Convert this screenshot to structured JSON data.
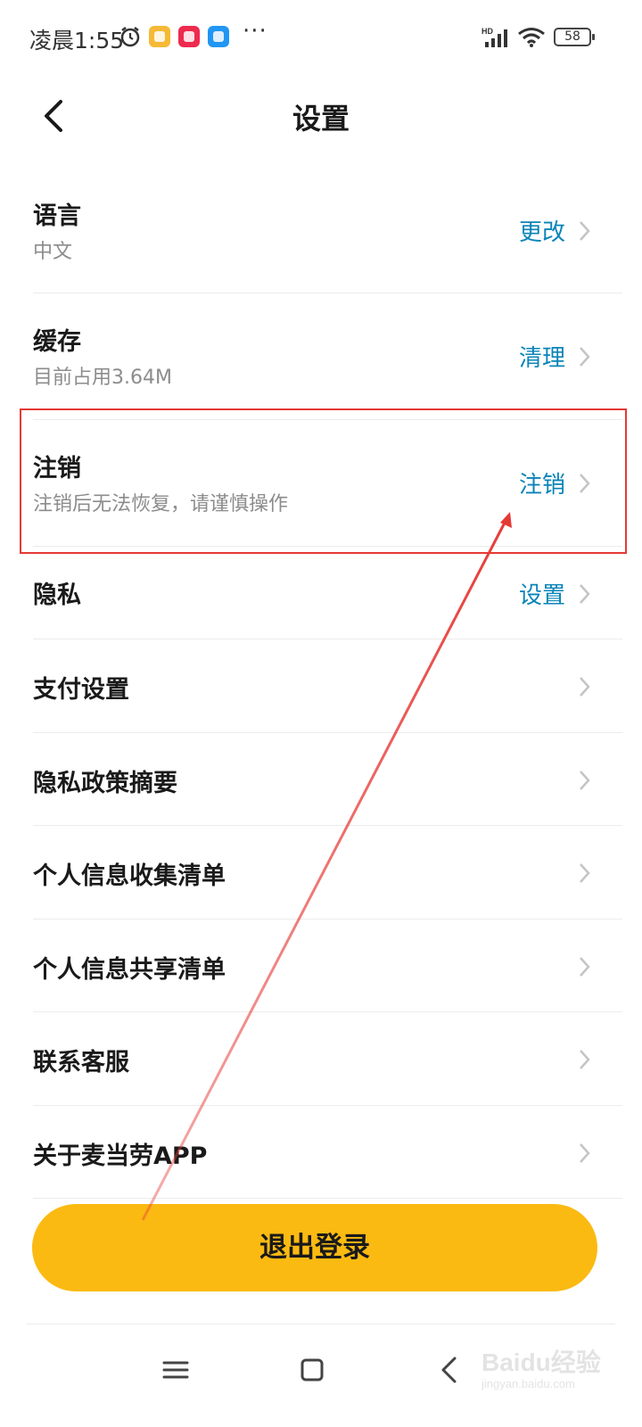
{
  "status_bar": {
    "time": "凌晨1:55",
    "more": "···",
    "battery": "58",
    "network": "HD",
    "icons": [
      "alarm-icon",
      "app-notification-icon",
      "xiaohongshu-icon",
      "cloud-icon",
      "signal-icon",
      "wifi-icon",
      "battery-icon"
    ]
  },
  "header": {
    "title": "设置"
  },
  "settings": [
    {
      "title": "语言",
      "subtitle": "中文",
      "action": "更改"
    },
    {
      "title": "缓存",
      "subtitle": "目前占用3.64M",
      "action": "清理"
    },
    {
      "title": "注销",
      "subtitle": "注销后无法恢复，请谨慎操作",
      "action": "注销"
    },
    {
      "title": "隐私",
      "subtitle": "",
      "action": "设置"
    },
    {
      "title": "支付设置",
      "subtitle": "",
      "action": ""
    },
    {
      "title": "隐私政策摘要",
      "subtitle": "",
      "action": ""
    },
    {
      "title": "个人信息收集清单",
      "subtitle": "",
      "action": ""
    },
    {
      "title": "个人信息共享清单",
      "subtitle": "",
      "action": ""
    },
    {
      "title": "联系客服",
      "subtitle": "",
      "action": ""
    },
    {
      "title": "关于麦当劳APP",
      "subtitle": "",
      "action": ""
    }
  ],
  "logout": {
    "label": "退出登录"
  },
  "watermark": {
    "logo": "Baidu经验",
    "url": "jingyan.baidu.com"
  },
  "colors": {
    "accent_link": "#0b84b8",
    "logout_bg": "#fbba12",
    "annotation_red": "#e53935"
  }
}
